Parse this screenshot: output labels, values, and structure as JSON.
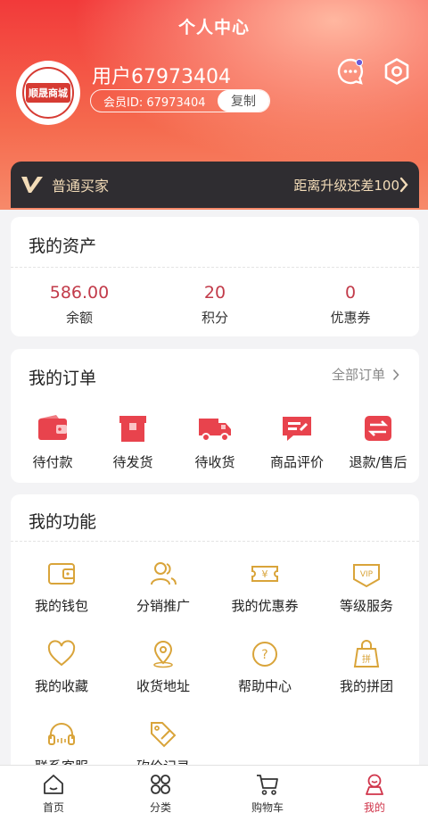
{
  "header": {
    "title": "个人中心",
    "avatar_text": "顺晟商城",
    "username": "用户67973404",
    "member_id": "会员ID: 67973404",
    "copy_label": "复制",
    "icons": [
      "message-icon",
      "settings-icon"
    ]
  },
  "level": {
    "name": "普通买家",
    "upgrade_text": "距离升级还差100"
  },
  "assets": {
    "title": "我的资产",
    "items": [
      {
        "value": "586.00",
        "label": "余额"
      },
      {
        "value": "20",
        "label": "积分"
      },
      {
        "value": "0",
        "label": "优惠券"
      }
    ]
  },
  "orders": {
    "title": "我的订单",
    "all_label": "全部订单",
    "items": [
      {
        "label": "待付款",
        "icon": "wallet-icon"
      },
      {
        "label": "待发货",
        "icon": "box-icon"
      },
      {
        "label": "待收货",
        "icon": "truck-icon"
      },
      {
        "label": "商品评价",
        "icon": "review-icon"
      },
      {
        "label": "退款/售后",
        "icon": "refund-icon"
      }
    ]
  },
  "functions": {
    "title": "我的功能",
    "items": [
      {
        "label": "我的钱包",
        "icon": "wallet-icon"
      },
      {
        "label": "分销推广",
        "icon": "users-icon"
      },
      {
        "label": "我的优惠券",
        "icon": "coupon-icon"
      },
      {
        "label": "等级服务",
        "icon": "vip-icon"
      },
      {
        "label": "我的收藏",
        "icon": "heart-icon"
      },
      {
        "label": "收货地址",
        "icon": "location-icon"
      },
      {
        "label": "帮助中心",
        "icon": "help-icon"
      },
      {
        "label": "我的拼团",
        "icon": "group-bag-icon"
      },
      {
        "label": "联系客服",
        "icon": "headset-icon"
      },
      {
        "label": "砍价记录",
        "icon": "bargain-icon"
      }
    ]
  },
  "tabbar": {
    "items": [
      {
        "label": "首页",
        "icon": "home-icon"
      },
      {
        "label": "分类",
        "icon": "category-icon"
      },
      {
        "label": "购物车",
        "icon": "cart-icon"
      },
      {
        "label": "我的",
        "icon": "profile-icon",
        "active": true
      }
    ]
  },
  "colors": {
    "brand_red": "#f23a3a",
    "icon_red": "#e8434d",
    "icon_gold": "#d9a43a",
    "level_bg": "#2f2d31",
    "level_text": "#f3dcb8",
    "asset_value": "#c23b4a",
    "tab_active": "#d0344a"
  }
}
